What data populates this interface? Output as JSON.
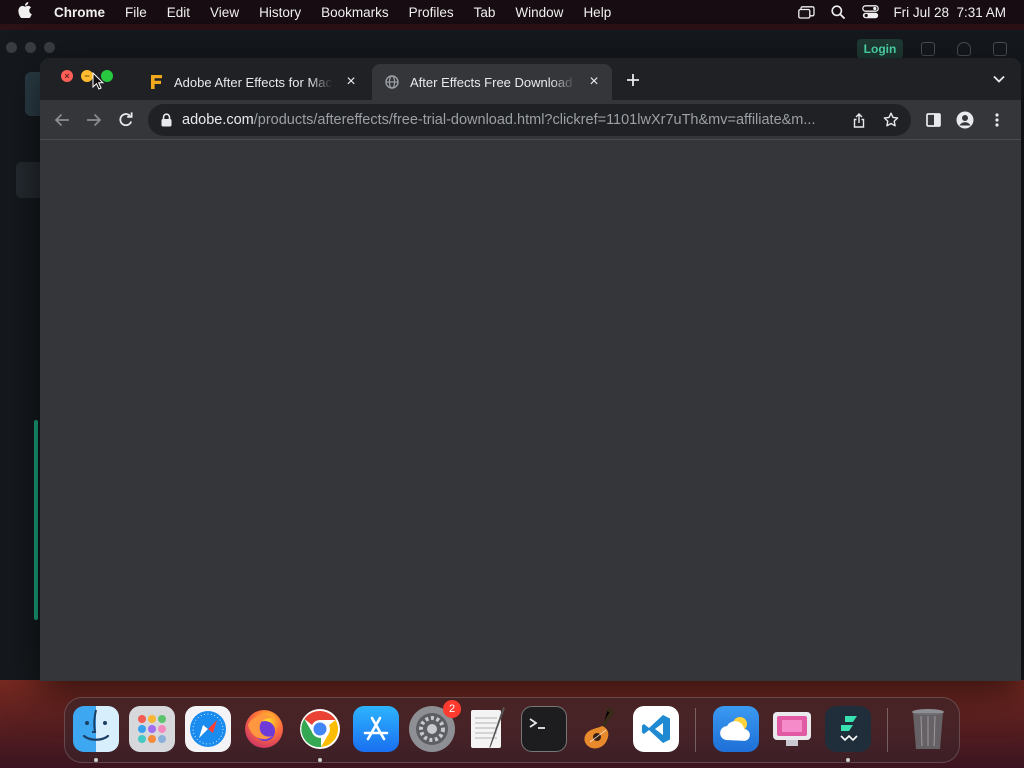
{
  "menubar": {
    "app_name": "Chrome",
    "items": [
      "File",
      "Edit",
      "View",
      "History",
      "Bookmarks",
      "Profiles",
      "Tab",
      "Window",
      "Help"
    ],
    "clock": "Fri Jul 28  7:31 AM"
  },
  "background_app": {
    "login_label": "Login"
  },
  "browser": {
    "tabs": [
      {
        "title": "Adobe After Effects for Mac Version",
        "favicon": "f-logo-icon",
        "active": false
      },
      {
        "title": "After Effects Free Download & Install",
        "favicon": "globe-icon",
        "active": true
      }
    ],
    "url_host": "adobe.com",
    "url_rest": "/products/aftereffects/free-trial-download.html?clickref=1101lwXr7uTh&mv=affiliate&m..."
  },
  "dock": {
    "apps": [
      {
        "name": "Finder",
        "icon": "finder-icon",
        "running": true
      },
      {
        "name": "Launchpad",
        "icon": "launchpad-icon",
        "running": false
      },
      {
        "name": "Safari",
        "icon": "safari-icon",
        "running": false
      },
      {
        "name": "Firefox",
        "icon": "firefox-icon",
        "running": false
      },
      {
        "name": "Google Chrome",
        "icon": "chrome-icon",
        "running": true
      },
      {
        "name": "App Store",
        "icon": "app-store-icon",
        "running": false
      },
      {
        "name": "System Settings",
        "icon": "settings-icon",
        "running": false,
        "badge": "2"
      },
      {
        "name": "TextEdit",
        "icon": "textedit-icon",
        "running": false
      },
      {
        "name": "Terminal",
        "icon": "terminal-icon",
        "running": false
      },
      {
        "name": "GarageBand",
        "icon": "garageband-icon",
        "running": false
      },
      {
        "name": "Visual Studio Code",
        "icon": "vscode-icon",
        "running": false
      },
      {
        "name": "Weather",
        "icon": "weather-icon",
        "running": false
      },
      {
        "name": "CleanMyMac",
        "icon": "cleanmymac-icon",
        "running": false
      },
      {
        "name": "Filmora",
        "icon": "filmora-icon",
        "running": true
      },
      {
        "name": "Trash",
        "icon": "trash-icon",
        "running": false
      }
    ]
  },
  "colors": {
    "chrome_frame": "#202124",
    "chrome_toolbar": "#35363a",
    "login_accent": "#4fe0b0"
  }
}
